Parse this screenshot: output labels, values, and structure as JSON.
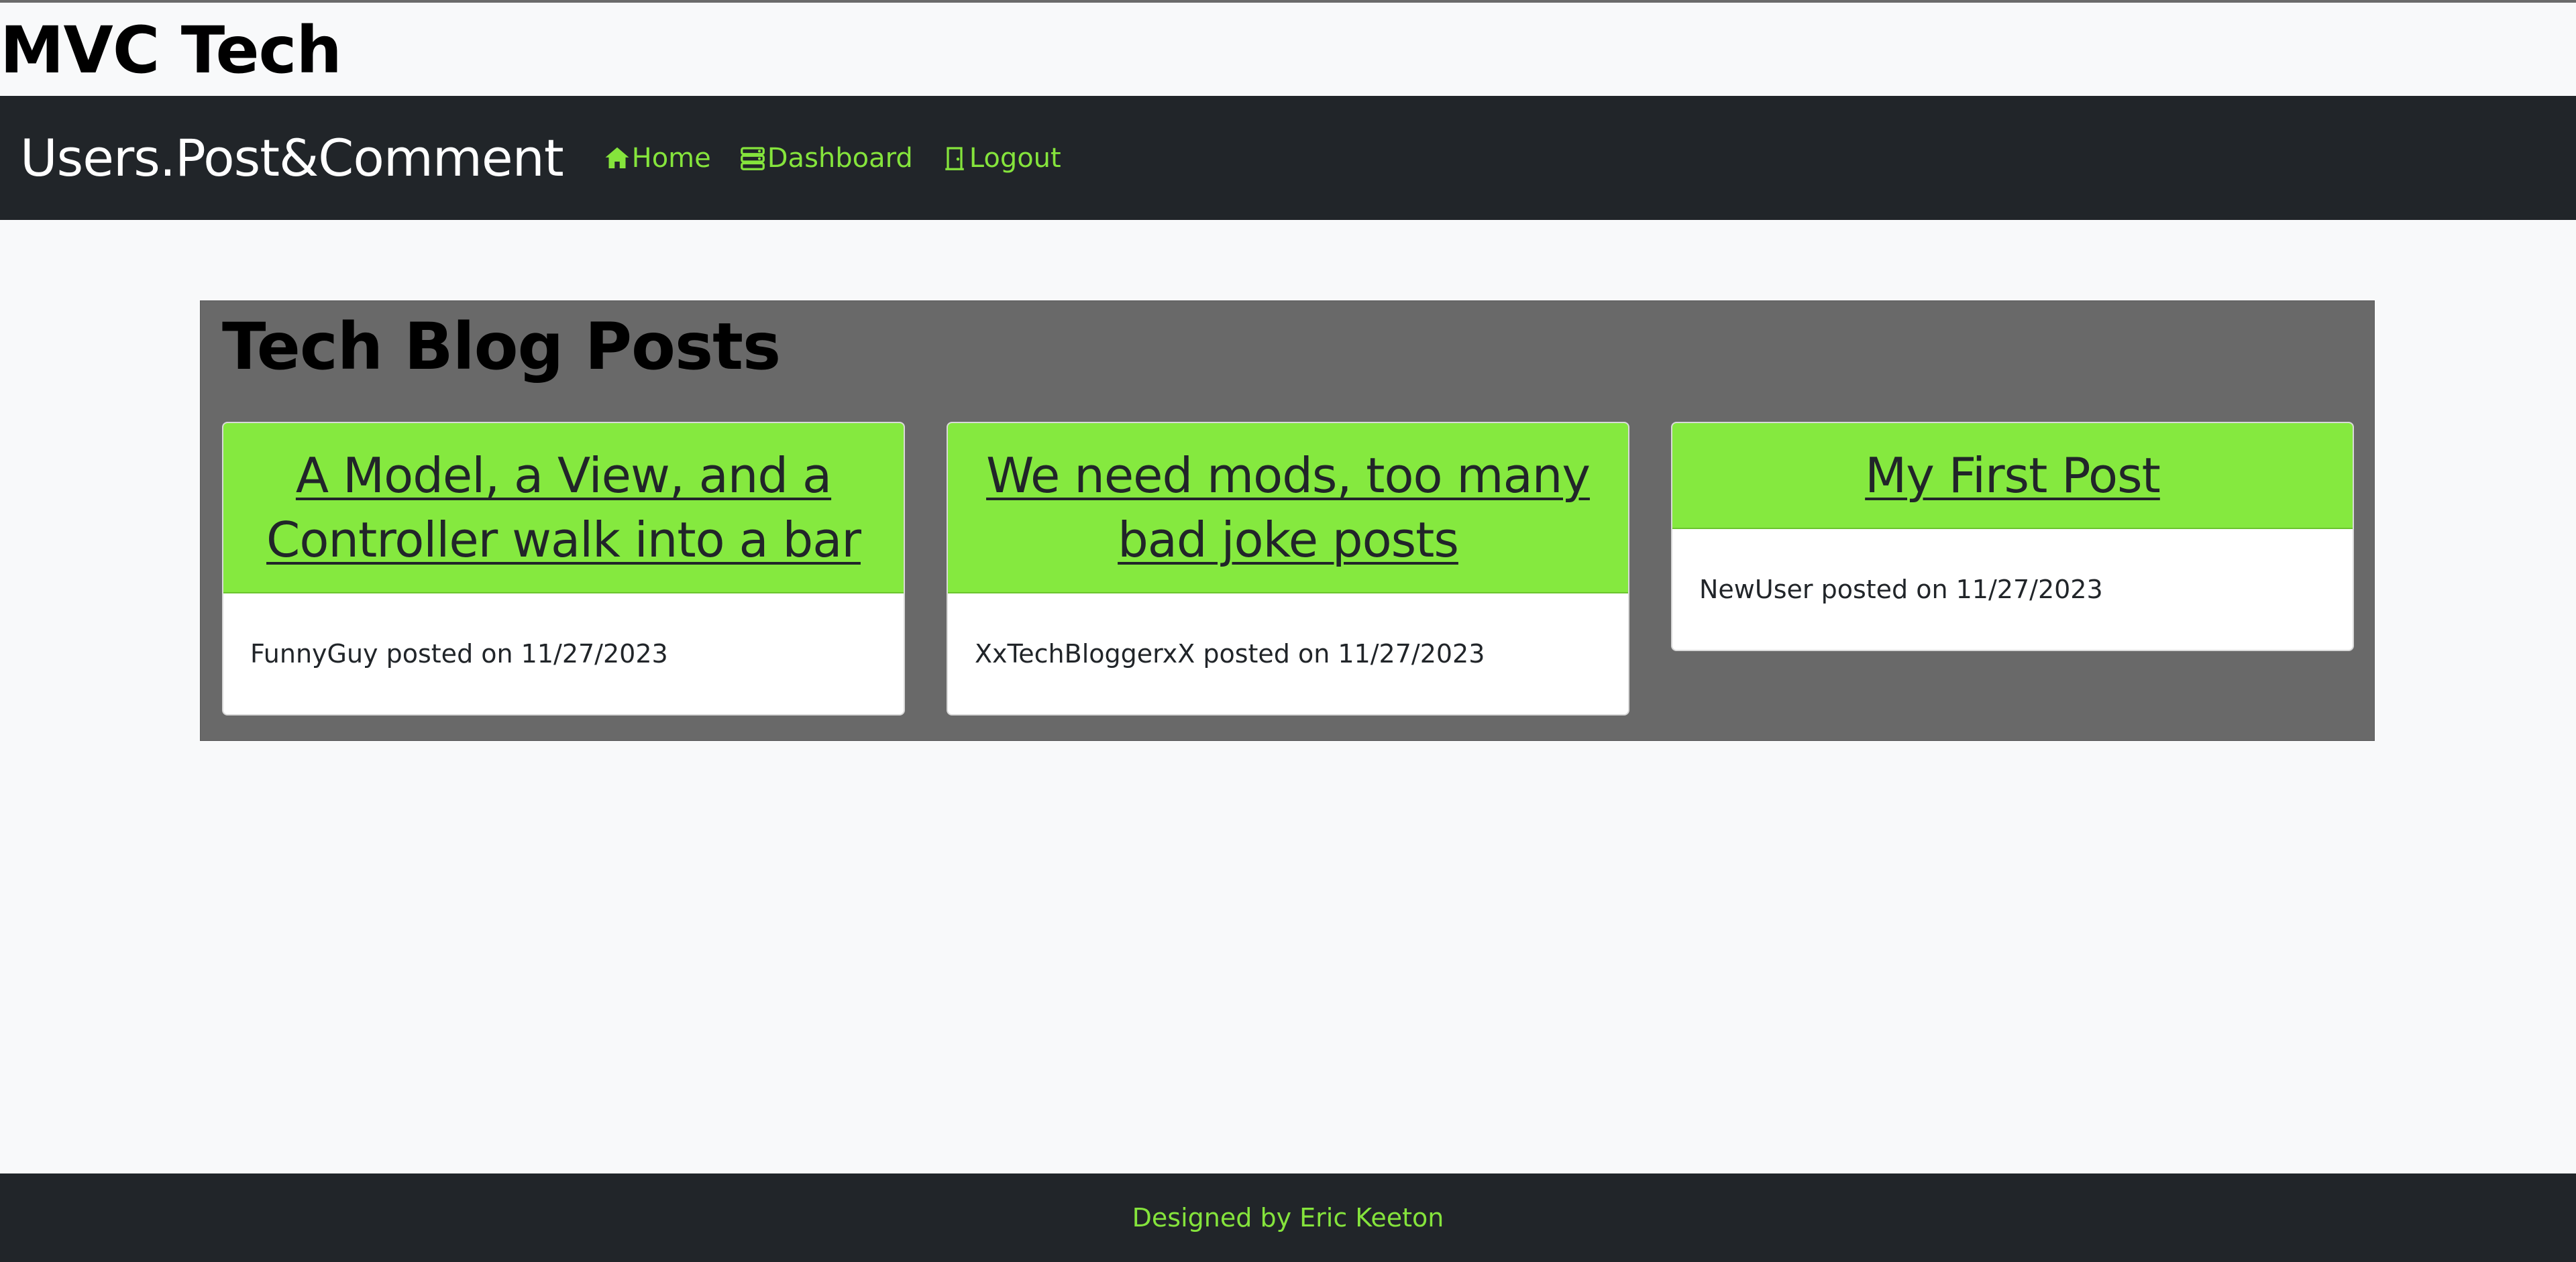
{
  "site": {
    "title": "MVC Tech"
  },
  "navbar": {
    "brand": "Users.Post&Comment",
    "links": [
      {
        "label": "Home",
        "icon": "house-icon"
      },
      {
        "label": "Dashboard",
        "icon": "dashboard-icon"
      },
      {
        "label": "Logout",
        "icon": "door-icon"
      }
    ]
  },
  "main": {
    "heading": "Tech Blog Posts",
    "posts": [
      {
        "title": "A Model, a View, and a Controller walk into a bar",
        "author": "FunnyGuy",
        "date": "11/27/2023",
        "meta": "FunnyGuy posted on 11/27/2023"
      },
      {
        "title": "We need mods, too many bad joke posts",
        "author": "XxTechBloggerxX",
        "date": "11/27/2023",
        "meta": "XxTechBloggerxX posted on 11/27/2023"
      },
      {
        "title": "My First Post",
        "author": "NewUser",
        "date": "11/27/2023",
        "meta": "NewUser posted on 11/27/2023"
      }
    ]
  },
  "footer": {
    "text": "Designed by Eric Keeton"
  },
  "colors": {
    "accent": "#85e43c",
    "card_header": "#85e93f",
    "navbar_bg": "#212529",
    "panel_bg": "#696969",
    "page_bg": "#f8f9fa"
  }
}
